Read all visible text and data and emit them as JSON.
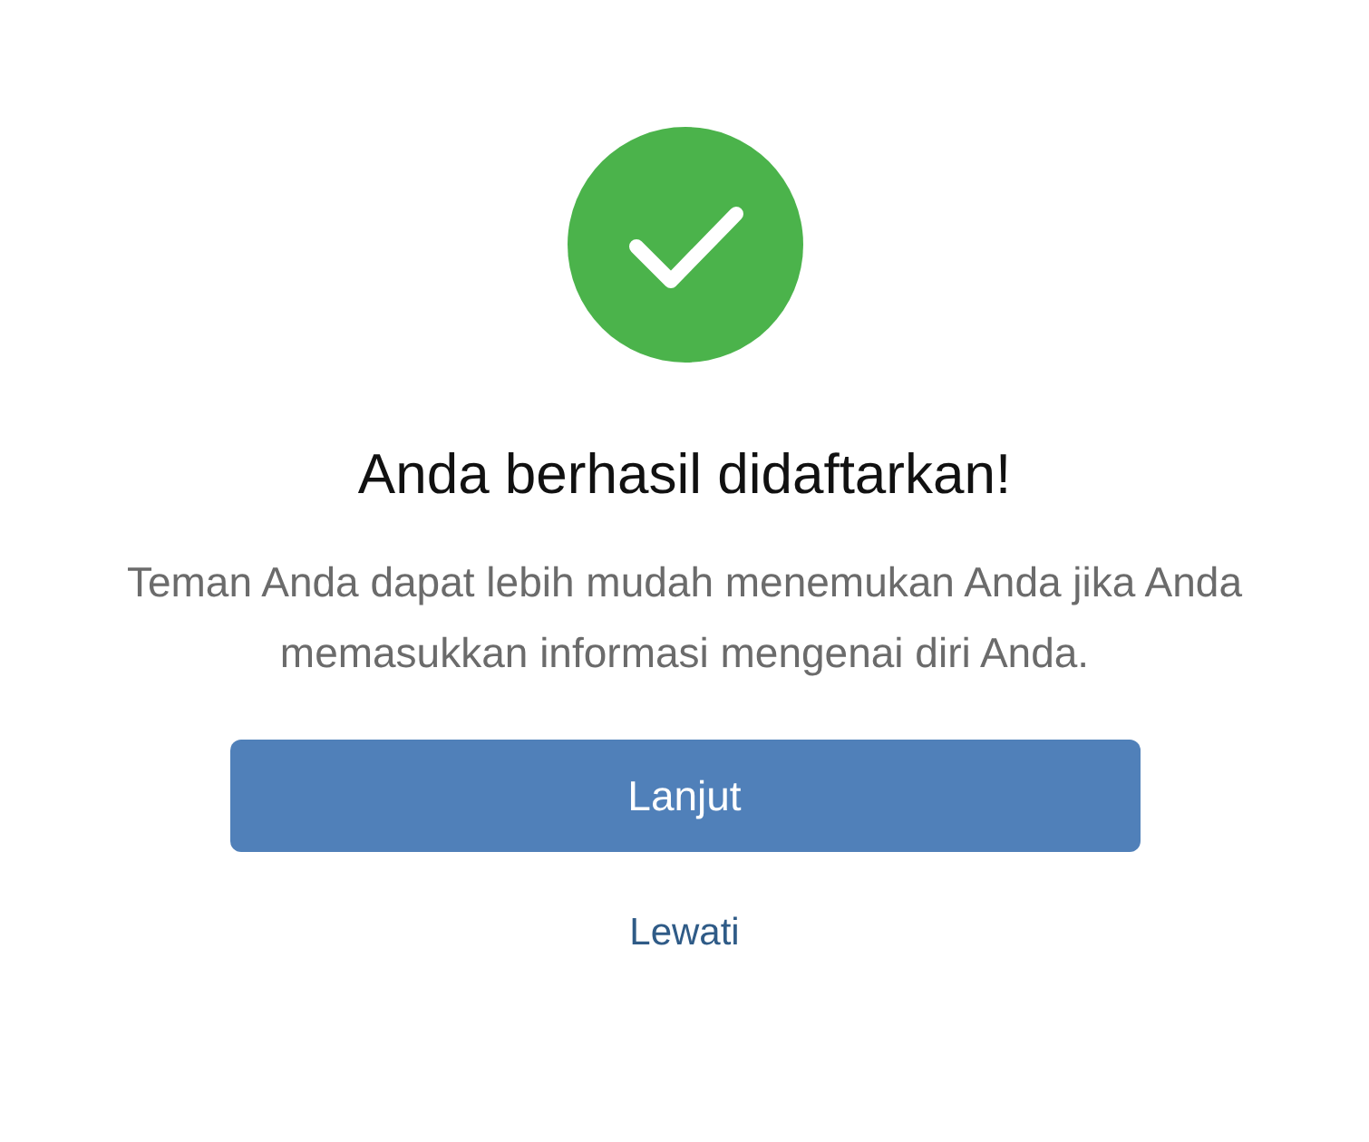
{
  "title": "Anda berhasil didaftarkan!",
  "message": "Teman Anda dapat lebih mudah menemukan Anda jika Anda memasukkan informasi mengenai diri Anda.",
  "primary_button": "Lanjut",
  "skip_link": "Lewati"
}
